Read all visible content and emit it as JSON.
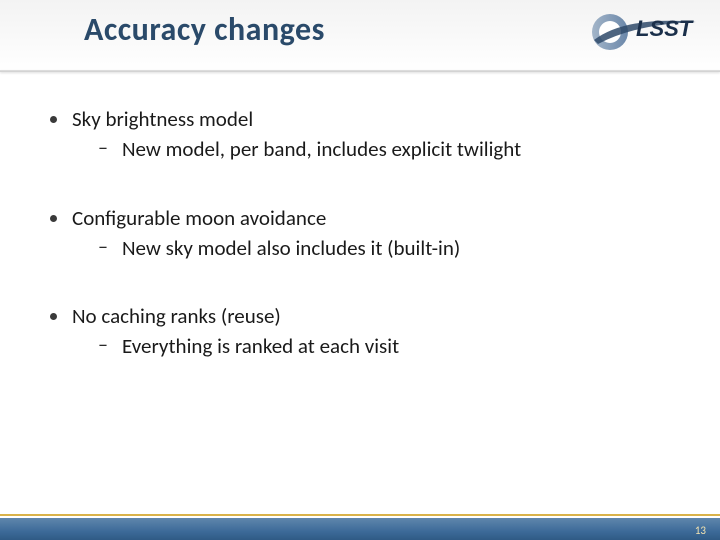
{
  "title": "Accuracy changes",
  "logo_text": "LSST",
  "bullets": [
    {
      "text": "Sky brightness model",
      "sub": [
        "New model, per band, includes explicit twilight"
      ]
    },
    {
      "text": "Configurable moon avoidance",
      "sub": [
        "New sky model also includes it (built-in)"
      ]
    },
    {
      "text": "No caching ranks (reuse)",
      "sub": [
        "Everything is ranked at each visit"
      ]
    }
  ],
  "page_number": "13"
}
